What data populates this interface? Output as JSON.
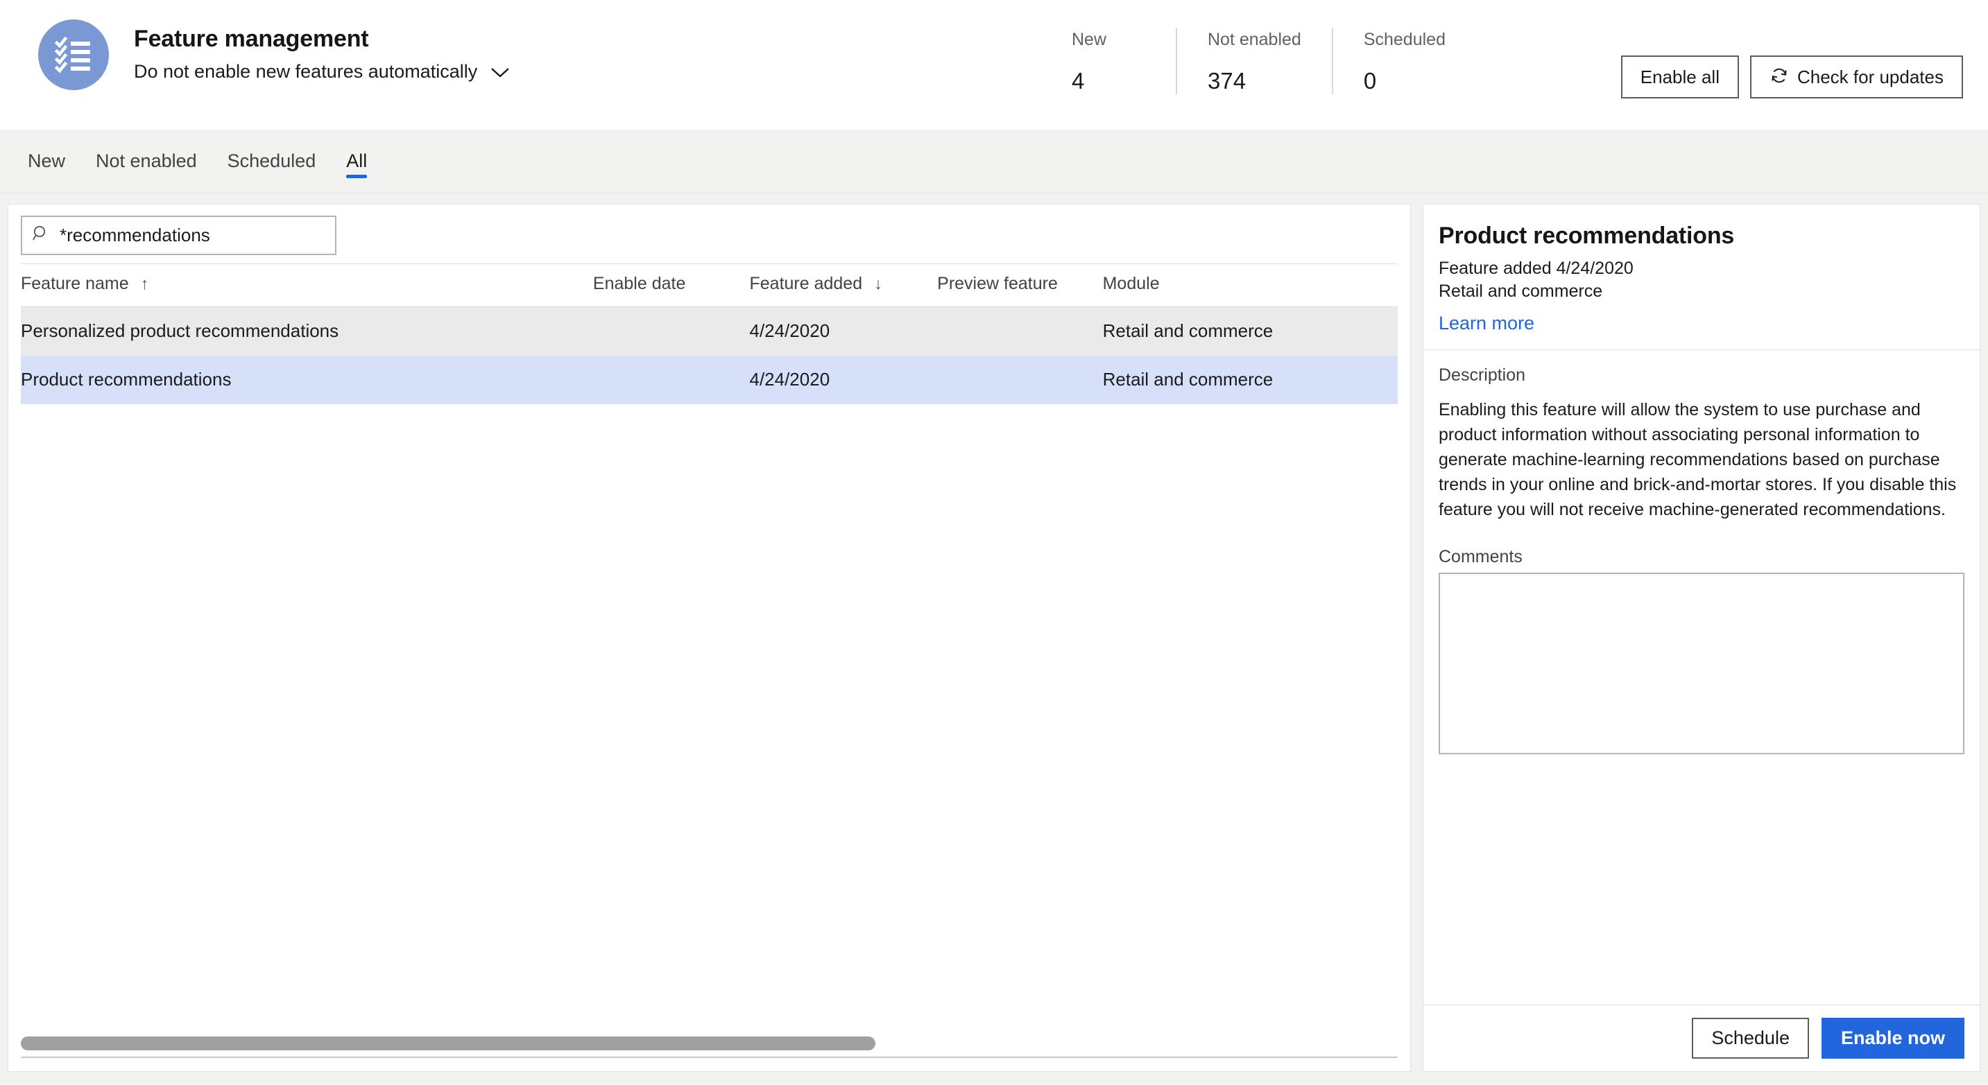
{
  "header": {
    "icon_name": "checklist-icon",
    "title": "Feature management",
    "subtitle": "Do not enable new features automatically",
    "chevron_icon": "chevron-down-icon",
    "stats": [
      {
        "label": "New",
        "value": "4"
      },
      {
        "label": "Not enabled",
        "value": "374"
      },
      {
        "label": "Scheduled",
        "value": "0"
      }
    ],
    "buttons": {
      "enable_all": "Enable all",
      "check_updates": "Check for updates",
      "refresh_icon": "refresh-icon"
    }
  },
  "tabs": [
    {
      "label": "New",
      "active": false
    },
    {
      "label": "Not enabled",
      "active": false
    },
    {
      "label": "Scheduled",
      "active": false
    },
    {
      "label": "All",
      "active": true
    }
  ],
  "list_pane": {
    "search": {
      "icon": "search-icon",
      "value": "*recommendations",
      "placeholder": "Filter"
    },
    "columns": [
      {
        "label": "Feature name",
        "sort": "↑"
      },
      {
        "label": "Enable date",
        "sort": ""
      },
      {
        "label": "Feature added",
        "sort": "↓"
      },
      {
        "label": "Preview feature",
        "sort": ""
      },
      {
        "label": "Module",
        "sort": ""
      }
    ],
    "rows": [
      {
        "feature_name": "Personalized product recommendations",
        "enable_date": "",
        "feature_added": "4/24/2020",
        "preview_feature": "",
        "module": "Retail and commerce",
        "state": "hover"
      },
      {
        "feature_name": "Product recommendations",
        "enable_date": "",
        "feature_added": "4/24/2020",
        "preview_feature": "",
        "module": "Retail and commerce",
        "state": "selected"
      }
    ],
    "scrollbar": "horizontal-scrollbar"
  },
  "detail_pane": {
    "title": "Product recommendations",
    "added_line": "Feature added 4/24/2020",
    "module_line": "Retail and commerce",
    "learn_more": "Learn more",
    "description_label": "Description",
    "description": "Enabling this feature will allow the system to use purchase and product information without associating personal information to generate machine-learning recommendations based on purchase trends in your online and brick-and-mortar stores. If you disable this feature you will not receive machine-generated recommendations.",
    "comments_label": "Comments",
    "comments_value": "",
    "buttons": {
      "schedule": "Schedule",
      "enable_now": "Enable now"
    }
  },
  "colors": {
    "accent": "#2266DD",
    "icon_circle": "#7A99D4",
    "row_selected": "#D6E0F8",
    "row_hover": "#EAEAEA",
    "page_bg": "#F2F2F1"
  }
}
